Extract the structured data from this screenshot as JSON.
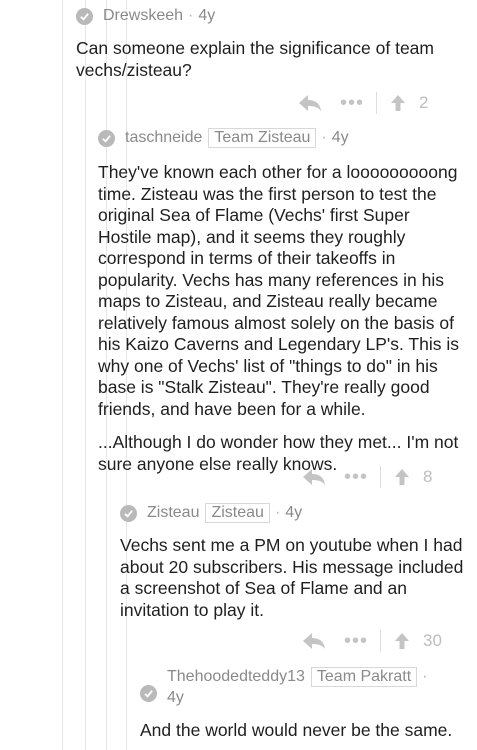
{
  "comments": [
    {
      "author": "Drewskeeh",
      "age": "4y",
      "body": [
        "Can someone explain the significance of team vechs/zisteau?"
      ],
      "score": "2"
    },
    {
      "author": "taschneide",
      "flair": "Team Zisteau",
      "age": "4y",
      "body": [
        "They've known each other for a looooooooong time. Zisteau was the first person to test the original Sea of Flame (Vechs' first Super Hostile map), and it seems they roughly correspond in terms of their takeoffs in popularity. Vechs has many references in his maps to Zisteau, and Zisteau really became relatively famous almost solely on the basis of his Kaizo Caverns and Legendary LP's. This is why one of Vechs' list of \"things to do\" in his base is \"Stalk Zisteau\". They're really good friends, and have been for a while.",
        "...Although I do wonder how they met... I'm not sure anyone else really knows."
      ],
      "score": "8"
    },
    {
      "author": "Zisteau",
      "flair": "Zisteau",
      "age": "4y",
      "body": [
        "Vechs sent me a PM on youtube when I had about 20 subscribers. His message included a screenshot of Sea of Flame and an invitation to play it."
      ],
      "score": "30"
    },
    {
      "author": "Thehoodedteddy13",
      "flair": "Team Pakratt",
      "age": "4y",
      "body": [
        "And the world would never be the same."
      ]
    }
  ],
  "icons": {
    "check": "check-icon",
    "reply": "reply-arrow-icon",
    "more": "more-dots-icon",
    "upvote": "upvote-arrow-icon"
  },
  "colors": {
    "meta": "#8a8a8a",
    "body": "#1f1f1f",
    "icon": "#c4c4c4",
    "thread_line": "#e6e6e6"
  }
}
